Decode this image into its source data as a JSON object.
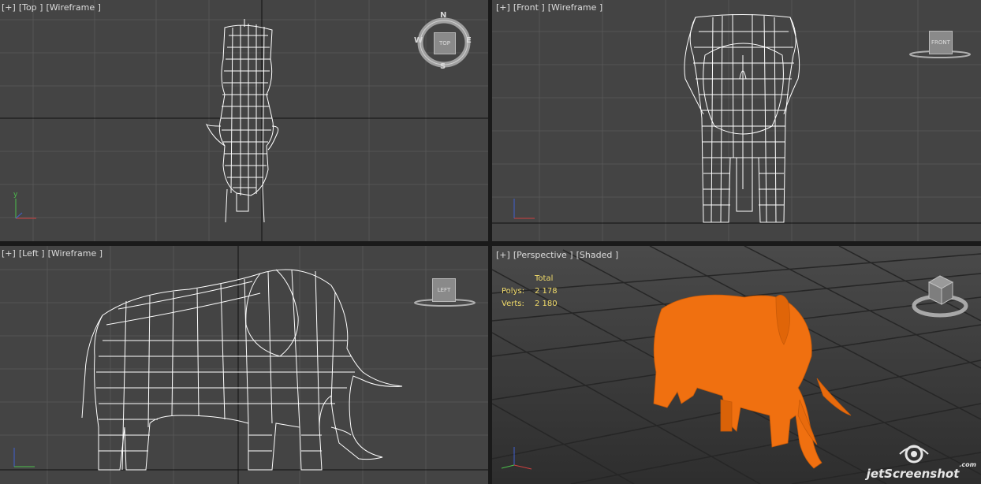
{
  "viewports": {
    "top": {
      "plus": "[+]",
      "view": "[Top ]",
      "mode": "[Wireframe ]",
      "cube_label": "TOP",
      "compass": {
        "n": "N",
        "s": "S",
        "e": "E",
        "w": "W"
      }
    },
    "front": {
      "plus": "[+]",
      "view": "[Front ]",
      "mode": "[Wireframe ]",
      "cube_label": "FRONT"
    },
    "left": {
      "plus": "[+]",
      "view": "[Left ]",
      "mode": "[Wireframe ]",
      "cube_label": "LEFT"
    },
    "perspective": {
      "plus": "[+]",
      "view": "[Perspective ]",
      "mode": "[Shaded ]",
      "stats": {
        "header": "Total",
        "polys_label": "Polys:",
        "polys_value": "2 178",
        "verts_label": "Verts:",
        "verts_value": "2 180"
      }
    }
  },
  "axis_labels": {
    "x": "x",
    "y": "y",
    "z": "z"
  },
  "colors": {
    "viewport_bg": "#444444",
    "grid": "#555555",
    "wire": "#ffffff",
    "model_shaded": "#f07010",
    "active_border": "#c8a15a"
  },
  "watermark": {
    "brand": "jetScreenshot",
    "suffix": ".com"
  }
}
